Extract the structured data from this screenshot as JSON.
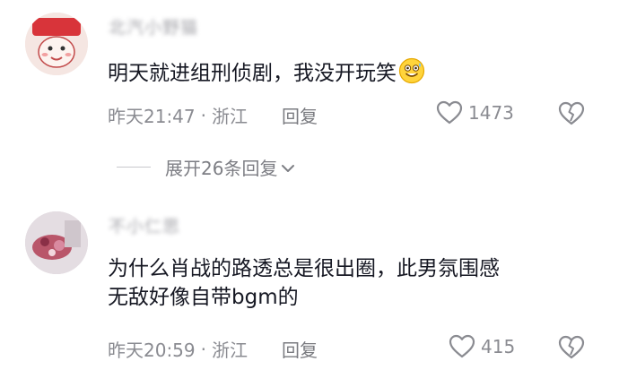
{
  "comments": [
    {
      "username": "北汽小野猫",
      "text": "明天就进组刑侦剧，我没开玩笑",
      "time": "昨天21:47",
      "location": "浙江",
      "reply_label": "回复",
      "likes": "1473",
      "emoji_icon": "grinning-sweat-emoji-icon"
    },
    {
      "username": "不小仁思",
      "text_line1": "为什么肖战的路透总是很出圈，此男氛围感",
      "text_line2": "无敌好像自带bgm的",
      "time": "昨天20:59",
      "location": "浙江",
      "reply_label": "回复",
      "likes": "415"
    }
  ],
  "expand_replies": {
    "label": "展开26条回复",
    "icon": "chevron-down-icon"
  },
  "separator": "·",
  "colors": {
    "text_primary": "#161823",
    "text_secondary": "#8a8b91",
    "divider": "#c7c8cc"
  }
}
